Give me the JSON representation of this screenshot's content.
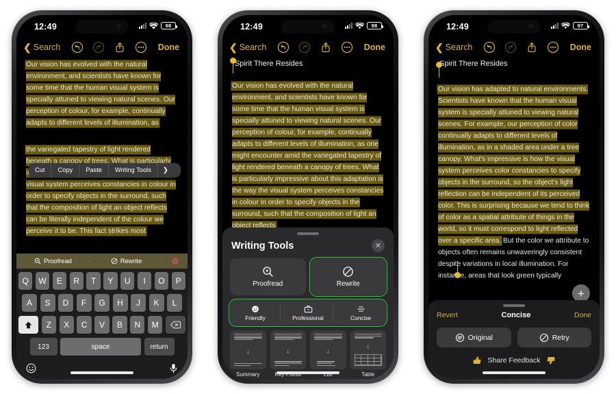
{
  "meta": {
    "accent_yellow": "#d9b33a",
    "highlight_olive": "#6d5d12",
    "selection_green": "#2fd33f"
  },
  "phones": [
    {
      "id": "phone-1",
      "status": {
        "time": "12:49",
        "battery": "98",
        "cellular_icon": "cellular-bars-icon",
        "wifi_icon": "wifi-icon",
        "battery_icon": "battery-icon"
      },
      "navbar": {
        "back_label": "Search",
        "back_icon": "chevron-left-icon",
        "undo_icon": "undo-icon",
        "redo_icon": "redo-icon",
        "share_icon": "share-icon",
        "more_icon": "more-ellipsis-icon",
        "done_label": "Done"
      },
      "note": {
        "title": "",
        "body_part1": "Our vision has evolved with the natural environment, and scientists have known for some time that the human visual system is specially attuned to viewing natural scenes. Our perception of colour, for example, continually adapts to different levels of illumination, as",
        "body_part2": "the variegated tapestry of light rendered beneath a canopy of trees. What is particularly impressive about this adaptation is the way the visual system perceives constancies in colour in order to specify objects in the surround, such that the composition of light an object reflects can be literally independent of the colour we perceive it to be. This fact strikes most"
      },
      "edit_menu": {
        "items": [
          "Cut",
          "Copy",
          "Paste",
          "Writing Tools"
        ],
        "more_icon": "chevron-right-icon"
      },
      "fab": {
        "icon": "plus-icon",
        "label": "+"
      },
      "keyboard": {
        "suggestions": [
          {
            "label": "Proofread",
            "icon": "proofread-magnifier-icon"
          },
          {
            "label": "Rewrite",
            "icon": "rewrite-pencil-circle-icon"
          },
          {
            "label": "",
            "icon": "apple-intelligence-icon"
          }
        ],
        "row1": [
          "Q",
          "W",
          "E",
          "R",
          "T",
          "Y",
          "U",
          "I",
          "O",
          "P"
        ],
        "row2": [
          "A",
          "S",
          "D",
          "F",
          "G",
          "H",
          "J",
          "K",
          "L"
        ],
        "row3": [
          "Z",
          "X",
          "C",
          "V",
          "B",
          "N",
          "M"
        ],
        "shift_icon": "shift-up-arrow-icon",
        "delete_icon": "backspace-delete-icon",
        "numbers_key": "123",
        "space_key": "space",
        "return_key": "return",
        "emoji_icon": "emoji-smiley-icon",
        "dictation_icon": "microphone-icon"
      }
    },
    {
      "id": "phone-2",
      "status": {
        "time": "12:49",
        "battery": "98",
        "cellular_icon": "cellular-bars-icon",
        "wifi_icon": "wifi-icon",
        "battery_icon": "battery-icon"
      },
      "navbar": {
        "back_label": "Search",
        "back_icon": "chevron-left-icon",
        "undo_icon": "undo-icon",
        "redo_icon": "redo-icon",
        "share_icon": "share-icon",
        "more_icon": "more-ellipsis-icon",
        "done_label": "Done"
      },
      "note": {
        "title": "Spirit There Resides",
        "body": "Our vision has evolved with the natural environment, and scientists have known for some time that the human visual system is specially attuned to viewing natural scenes. Our perception of colour, for example, continually adapts to different levels of illumination, as one might encounter amid the variegated tapestry of light rendered beneath a canopy of trees. What is particularly impressive about this adaptation is the way the visual system perceives constancies in colour in order to specify objects in the surround, such that the composition of light an object reflects"
      },
      "fab": {
        "icon": "plus-icon",
        "label": "+"
      },
      "writing_tools": {
        "title": "Writing Tools",
        "close_icon": "close-x-icon",
        "primary": [
          {
            "label": "Proofread",
            "icon": "proofread-magnifier-icon",
            "selected": false
          },
          {
            "label": "Rewrite",
            "icon": "rewrite-pencil-circle-icon",
            "selected": true
          }
        ],
        "tones": [
          {
            "label": "Friendly",
            "icon": "friendly-smiley-icon"
          },
          {
            "label": "Professional",
            "icon": "briefcase-icon"
          },
          {
            "label": "Concise",
            "icon": "concise-divide-icon"
          }
        ],
        "tones_selected": true,
        "documents": [
          {
            "label": "Summary",
            "icon": "summary-doc-icon"
          },
          {
            "label": "Key Points",
            "icon": "key-points-doc-icon"
          },
          {
            "label": "List",
            "icon": "list-doc-icon"
          },
          {
            "label": "Table",
            "icon": "table-doc-icon"
          }
        ]
      }
    },
    {
      "id": "phone-3",
      "status": {
        "time": "12:49",
        "battery": "97",
        "cellular_icon": "cellular-bars-icon",
        "wifi_icon": "wifi-icon",
        "battery_icon": "battery-icon"
      },
      "navbar": {
        "back_label": "Search",
        "back_icon": "chevron-left-icon",
        "undo_icon": "undo-icon",
        "redo_icon": "redo-icon",
        "share_icon": "share-icon",
        "more_icon": "more-ellipsis-icon",
        "done_label": "Done"
      },
      "note": {
        "title": "Spirit There Resides",
        "body_highlighted": "Our vision has adapted to natural environments. Scientists have known that the human visual system is specially attuned to viewing natural scenes. For example, our perception of color continually adapts to different levels of illumination, as in a shaded area under a tree canopy. What's impressive is how the visual system perceives color constancies to specify objects in the surround, so the object's light reflection can be independent of its perceived color. This is surprising because we tend to think of color as a spatial attribute of things in the world, so it must correspond to light reflected over a specific area.",
        "body_plain": " But the color we attribute to objects often remains unwaveringly consistent despite variations in local illumination. For instance, areas that look green typically"
      },
      "fab": {
        "icon": "plus-icon",
        "label": "+"
      },
      "result": {
        "revert_label": "Revert",
        "title": "Concise",
        "done_label": "Done",
        "buttons": [
          {
            "label": "Original",
            "icon": "original-lines-circle-icon"
          },
          {
            "label": "Retry",
            "icon": "retry-pencil-circle-icon"
          }
        ],
        "feedback_label": "Share Feedback",
        "thumbs_up_icon": "thumbs-up-icon",
        "thumbs_down_icon": "thumbs-down-icon"
      }
    }
  ]
}
